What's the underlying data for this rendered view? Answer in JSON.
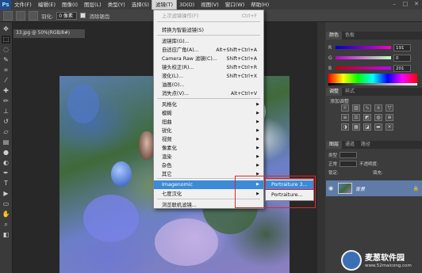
{
  "app": {
    "logo": "Ps"
  },
  "menubar": {
    "items": [
      "文件(F)",
      "编辑(E)",
      "图像(I)",
      "图层(L)",
      "类型(Y)",
      "选择(S)",
      "滤镜(T)",
      "3D(D)",
      "视图(V)",
      "窗口(W)",
      "帮助(H)"
    ],
    "active_index": 6
  },
  "options": {
    "feather_label": "羽化:",
    "feather_value": "0 像素",
    "antialias_label": "消除锯齿"
  },
  "document": {
    "tab_title": "33.jpg @ 50%(RGB/8#)"
  },
  "filter_menu": {
    "items": [
      {
        "label": "上次滤镜操作(F)",
        "shortcut": "Ctrl+F",
        "disabled": true
      },
      {
        "label": "转换为智能滤镜(S)"
      },
      {
        "label": "滤镜库(G)..."
      },
      {
        "label": "自适应广角(A)...",
        "shortcut": "Alt+Shift+Ctrl+A"
      },
      {
        "label": "Camera Raw 滤镜(C)...",
        "shortcut": "Shift+Ctrl+A"
      },
      {
        "label": "镜头校正(R)...",
        "shortcut": "Shift+Ctrl+R"
      },
      {
        "label": "液化(L)...",
        "shortcut": "Shift+Ctrl+X"
      },
      {
        "label": "油画(O)..."
      },
      {
        "label": "消失点(V)...",
        "shortcut": "Alt+Ctrl+V"
      },
      {
        "label": "风格化",
        "submenu": true
      },
      {
        "label": "模糊",
        "submenu": true
      },
      {
        "label": "扭曲",
        "submenu": true
      },
      {
        "label": "锐化",
        "submenu": true
      },
      {
        "label": "视频",
        "submenu": true
      },
      {
        "label": "像素化",
        "submenu": true
      },
      {
        "label": "渲染",
        "submenu": true
      },
      {
        "label": "杂色",
        "submenu": true
      },
      {
        "label": "其它",
        "submenu": true
      },
      {
        "label": "Imagenomic",
        "submenu": true,
        "highlighted": true
      },
      {
        "label": "七度汉化",
        "submenu": true
      },
      {
        "label": "浏览联机滤镜..."
      }
    ]
  },
  "submenu": {
    "items": [
      {
        "label": "Portraiture 3...",
        "highlighted": true
      },
      {
        "label": "Portraiture..."
      }
    ]
  },
  "color_panel": {
    "tabs": [
      "颜色",
      "色板"
    ],
    "sliders": [
      {
        "label": "R",
        "value": "191"
      },
      {
        "label": "G",
        "value": "0"
      },
      {
        "label": "B",
        "value": "201"
      }
    ]
  },
  "adjust_panel": {
    "tabs": [
      "调整",
      "样式"
    ],
    "title": "添加调整"
  },
  "layers_panel": {
    "tabs": [
      "图层",
      "通道",
      "路径"
    ],
    "kind_label": "类型",
    "mode_label": "正常",
    "opacity_label": "不透明度:",
    "lock_label": "锁定:",
    "fill_label": "填充:",
    "layer_name": "背景"
  },
  "watermark": {
    "name": "麦葱软件园",
    "url": "www.52maicong.com"
  },
  "colors": {
    "highlight": "#3c8ad8",
    "annotation": "#e0262a"
  }
}
